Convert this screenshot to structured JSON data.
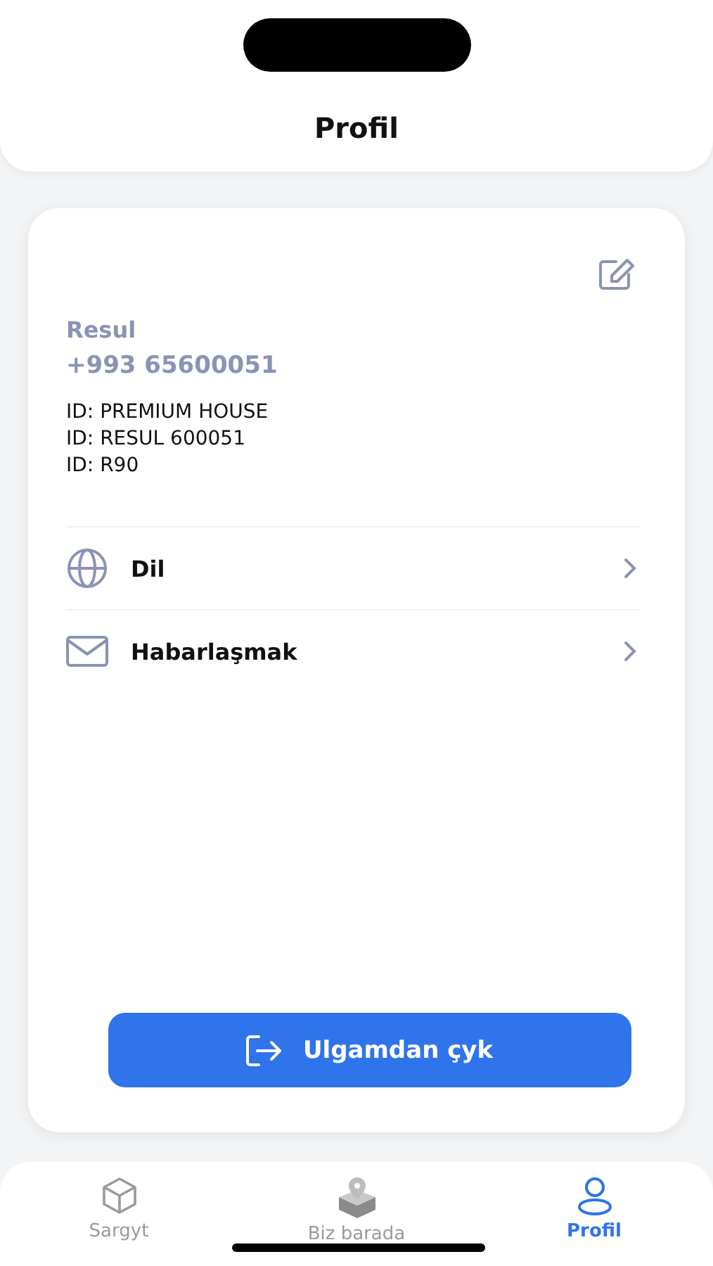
{
  "header": {
    "title": "Profil"
  },
  "profile": {
    "name": "Resul",
    "phone": "+993 65600051",
    "ids": [
      "ID: PREMIUM HOUSE",
      "ID: RESUL 600051",
      "ID: R90"
    ]
  },
  "menu": [
    {
      "kind": "globe",
      "label": "Dil"
    },
    {
      "kind": "mail",
      "label": "Habarlaşmak"
    }
  ],
  "logout": {
    "label": "Ulgamdan çyk"
  },
  "tabs": [
    {
      "kind": "cube",
      "label": "Sargyt",
      "selected": false
    },
    {
      "kind": "box-pin",
      "label": "Biz barada",
      "selected": false
    },
    {
      "kind": "user",
      "label": "Profil",
      "selected": true
    }
  ]
}
